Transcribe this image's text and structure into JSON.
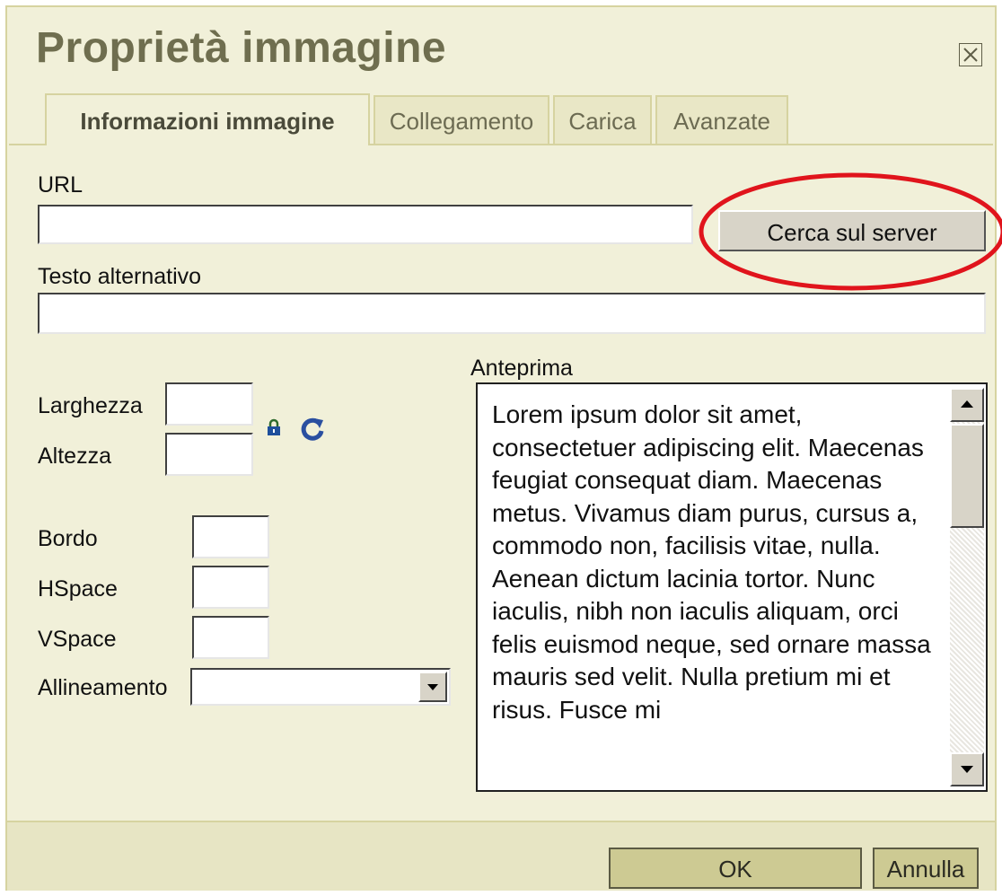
{
  "dialog": {
    "title": "Proprietà immagine"
  },
  "tabs": [
    {
      "label": "Informazioni immagine",
      "active": true
    },
    {
      "label": "Collegamento",
      "active": false
    },
    {
      "label": "Carica",
      "active": false
    },
    {
      "label": "Avanzate",
      "active": false
    }
  ],
  "form": {
    "url_label": "URL",
    "url_value": "",
    "browse_server_label": "Cerca sul server",
    "alt_text_label": "Testo alternativo",
    "alt_text_value": "",
    "width_label": "Larghezza",
    "width_value": "",
    "height_label": "Altezza",
    "height_value": "",
    "border_label": "Bordo",
    "border_value": "",
    "hspace_label": "HSpace",
    "hspace_value": "",
    "vspace_label": "VSpace",
    "vspace_value": "",
    "align_label": "Allineamento",
    "align_value": ""
  },
  "icons": {
    "lock": "lock-icon",
    "reset": "reset-size-icon",
    "close": "close-icon"
  },
  "preview": {
    "label": "Anteprima",
    "text": "Lorem ipsum dolor sit amet, consectetuer adipiscing elit. Maecenas feugiat consequat diam. Maecenas metus. Vivamus diam purus, cursus a, commodo non, facilisis vitae, nulla. Aenean dictum lacinia tortor. Nunc iaculis, nibh non iaculis aliquam, orci felis euismod neque, sed ornare massa mauris sed velit. Nulla pretium mi et risus. Fusce mi"
  },
  "footer": {
    "ok_label": "OK",
    "cancel_label": "Annulla"
  },
  "colors": {
    "dialog_bg": "#f1f0d9",
    "title": "#6f6e4f",
    "annotation": "#e0141c",
    "footer_button": "#cdca93"
  }
}
